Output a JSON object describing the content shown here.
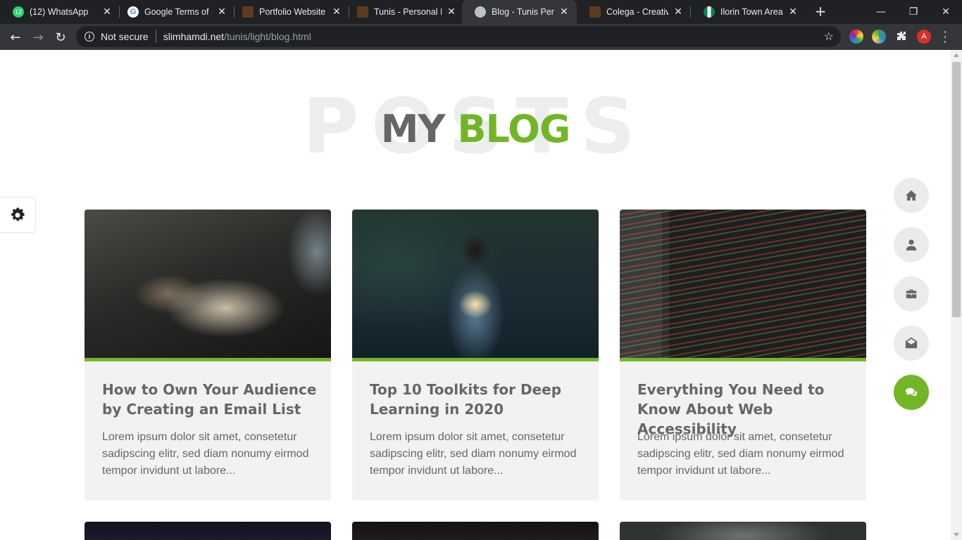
{
  "browser": {
    "tabs": [
      {
        "title": "(12) WhatsApp",
        "favicon": "whatsapp-icon",
        "badge": "12"
      },
      {
        "title": "Google Terms of Se",
        "favicon": "google-icon",
        "badge": "G"
      },
      {
        "title": "Portfolio Website T",
        "favicon": "themeforest-icon",
        "badge": ""
      },
      {
        "title": "Tunis - Personal Po",
        "favicon": "themeforest-icon",
        "badge": ""
      },
      {
        "title": "Blog - Tunis Person",
        "favicon": "globe-icon",
        "badge": ""
      },
      {
        "title": "Colega - Creative P",
        "favicon": "themeforest-icon",
        "badge": ""
      },
      {
        "title": "Ilorin Town Area Zo",
        "favicon": "nigeria-flag-icon",
        "badge": ""
      }
    ],
    "new_tab_label": "+",
    "window_controls": {
      "minimize": "—",
      "restore": "❐",
      "close": "✕"
    },
    "nav": {
      "back": "←",
      "forward": "→",
      "reload": "↻"
    },
    "omnibox": {
      "security_label": "Not secure",
      "url_host": "slimhamdi.net",
      "url_path": "/tunis/light/blog.html"
    },
    "profile_initial": "A"
  },
  "page": {
    "background_word": "POSTS",
    "heading_part1": "MY",
    "heading_part2": "BLOG",
    "accent_color": "#72b626",
    "side_nav": [
      {
        "name": "home",
        "icon": "home-icon",
        "active": false
      },
      {
        "name": "about",
        "icon": "user-icon",
        "active": false
      },
      {
        "name": "portfolio",
        "icon": "briefcase-icon",
        "active": false
      },
      {
        "name": "contact",
        "icon": "envelope-open-icon",
        "active": false
      },
      {
        "name": "blog",
        "icon": "comments-icon",
        "active": true
      }
    ],
    "posts": [
      {
        "title": "How to Own Your Audience by Creating an Email List",
        "excerpt": "Lorem ipsum dolor sit amet, consetetur sadipscing elitr, sed diam nonumy eirmod tempor invidunt ut labore..."
      },
      {
        "title": "Top 10 Toolkits for Deep Learning in 2020",
        "excerpt": "Lorem ipsum dolor sit amet, consetetur sadipscing elitr, sed diam nonumy eirmod tempor invidunt ut labore..."
      },
      {
        "title": "Everything You Need to Know About Web Accessibility",
        "excerpt": "Lorem ipsum dolor sit amet, consetetur sadipscing elitr, sed diam nonumy eirmod tempor invidunt ut labore..."
      }
    ]
  }
}
